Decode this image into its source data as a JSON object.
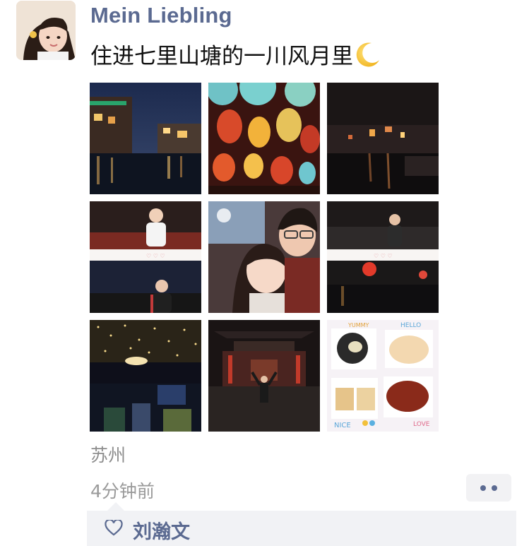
{
  "post": {
    "author": "Mein Liebling",
    "text": "住进七里山塘的一川风月里",
    "emoji": "crescent-moon-icon",
    "location": "苏州",
    "time": "4分钟前"
  },
  "photos": [
    "night-canal-town-photo",
    "lantern-market-photo",
    "dark-river-street-photo",
    "couple-collage-left-photo",
    "couple-selfie-photo",
    "couple-collage-right-photo",
    "starry-lights-photo",
    "temple-gate-photo",
    "food-collage-photo"
  ],
  "food_collage": {
    "yummy": "YUMMY",
    "hello": "HELLO",
    "nice": "NICE",
    "love": "LOVE"
  },
  "likes": {
    "names": "刘瀚文"
  },
  "colors": {
    "link": "#5b6a91",
    "meta": "#9a9a9a",
    "panel": "#f1f2f5"
  }
}
